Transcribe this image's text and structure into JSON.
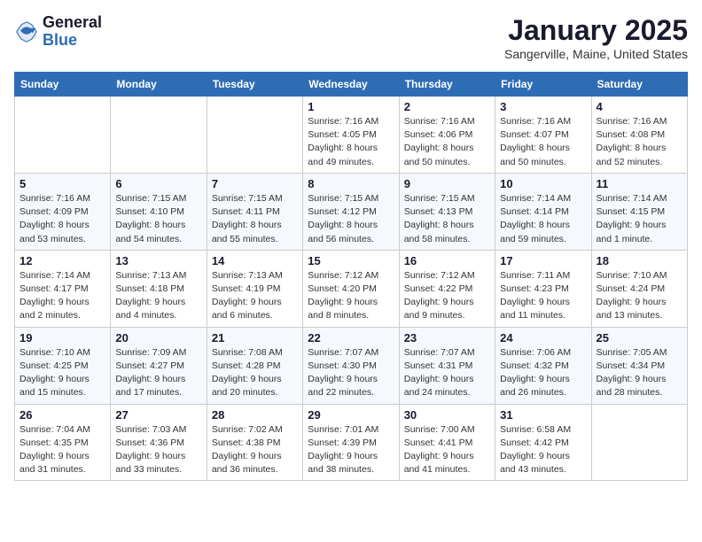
{
  "logo": {
    "line1": "General",
    "line2": "Blue"
  },
  "header": {
    "month": "January 2025",
    "location": "Sangerville, Maine, United States"
  },
  "weekdays": [
    "Sunday",
    "Monday",
    "Tuesday",
    "Wednesday",
    "Thursday",
    "Friday",
    "Saturday"
  ],
  "weeks": [
    [
      {
        "day": "",
        "info": ""
      },
      {
        "day": "",
        "info": ""
      },
      {
        "day": "",
        "info": ""
      },
      {
        "day": "1",
        "info": "Sunrise: 7:16 AM\nSunset: 4:05 PM\nDaylight: 8 hours\nand 49 minutes."
      },
      {
        "day": "2",
        "info": "Sunrise: 7:16 AM\nSunset: 4:06 PM\nDaylight: 8 hours\nand 50 minutes."
      },
      {
        "day": "3",
        "info": "Sunrise: 7:16 AM\nSunset: 4:07 PM\nDaylight: 8 hours\nand 50 minutes."
      },
      {
        "day": "4",
        "info": "Sunrise: 7:16 AM\nSunset: 4:08 PM\nDaylight: 8 hours\nand 52 minutes."
      }
    ],
    [
      {
        "day": "5",
        "info": "Sunrise: 7:16 AM\nSunset: 4:09 PM\nDaylight: 8 hours\nand 53 minutes."
      },
      {
        "day": "6",
        "info": "Sunrise: 7:15 AM\nSunset: 4:10 PM\nDaylight: 8 hours\nand 54 minutes."
      },
      {
        "day": "7",
        "info": "Sunrise: 7:15 AM\nSunset: 4:11 PM\nDaylight: 8 hours\nand 55 minutes."
      },
      {
        "day": "8",
        "info": "Sunrise: 7:15 AM\nSunset: 4:12 PM\nDaylight: 8 hours\nand 56 minutes."
      },
      {
        "day": "9",
        "info": "Sunrise: 7:15 AM\nSunset: 4:13 PM\nDaylight: 8 hours\nand 58 minutes."
      },
      {
        "day": "10",
        "info": "Sunrise: 7:14 AM\nSunset: 4:14 PM\nDaylight: 8 hours\nand 59 minutes."
      },
      {
        "day": "11",
        "info": "Sunrise: 7:14 AM\nSunset: 4:15 PM\nDaylight: 9 hours\nand 1 minute."
      }
    ],
    [
      {
        "day": "12",
        "info": "Sunrise: 7:14 AM\nSunset: 4:17 PM\nDaylight: 9 hours\nand 2 minutes."
      },
      {
        "day": "13",
        "info": "Sunrise: 7:13 AM\nSunset: 4:18 PM\nDaylight: 9 hours\nand 4 minutes."
      },
      {
        "day": "14",
        "info": "Sunrise: 7:13 AM\nSunset: 4:19 PM\nDaylight: 9 hours\nand 6 minutes."
      },
      {
        "day": "15",
        "info": "Sunrise: 7:12 AM\nSunset: 4:20 PM\nDaylight: 9 hours\nand 8 minutes."
      },
      {
        "day": "16",
        "info": "Sunrise: 7:12 AM\nSunset: 4:22 PM\nDaylight: 9 hours\nand 9 minutes."
      },
      {
        "day": "17",
        "info": "Sunrise: 7:11 AM\nSunset: 4:23 PM\nDaylight: 9 hours\nand 11 minutes."
      },
      {
        "day": "18",
        "info": "Sunrise: 7:10 AM\nSunset: 4:24 PM\nDaylight: 9 hours\nand 13 minutes."
      }
    ],
    [
      {
        "day": "19",
        "info": "Sunrise: 7:10 AM\nSunset: 4:25 PM\nDaylight: 9 hours\nand 15 minutes."
      },
      {
        "day": "20",
        "info": "Sunrise: 7:09 AM\nSunset: 4:27 PM\nDaylight: 9 hours\nand 17 minutes."
      },
      {
        "day": "21",
        "info": "Sunrise: 7:08 AM\nSunset: 4:28 PM\nDaylight: 9 hours\nand 20 minutes."
      },
      {
        "day": "22",
        "info": "Sunrise: 7:07 AM\nSunset: 4:30 PM\nDaylight: 9 hours\nand 22 minutes."
      },
      {
        "day": "23",
        "info": "Sunrise: 7:07 AM\nSunset: 4:31 PM\nDaylight: 9 hours\nand 24 minutes."
      },
      {
        "day": "24",
        "info": "Sunrise: 7:06 AM\nSunset: 4:32 PM\nDaylight: 9 hours\nand 26 minutes."
      },
      {
        "day": "25",
        "info": "Sunrise: 7:05 AM\nSunset: 4:34 PM\nDaylight: 9 hours\nand 28 minutes."
      }
    ],
    [
      {
        "day": "26",
        "info": "Sunrise: 7:04 AM\nSunset: 4:35 PM\nDaylight: 9 hours\nand 31 minutes."
      },
      {
        "day": "27",
        "info": "Sunrise: 7:03 AM\nSunset: 4:36 PM\nDaylight: 9 hours\nand 33 minutes."
      },
      {
        "day": "28",
        "info": "Sunrise: 7:02 AM\nSunset: 4:38 PM\nDaylight: 9 hours\nand 36 minutes."
      },
      {
        "day": "29",
        "info": "Sunrise: 7:01 AM\nSunset: 4:39 PM\nDaylight: 9 hours\nand 38 minutes."
      },
      {
        "day": "30",
        "info": "Sunrise: 7:00 AM\nSunset: 4:41 PM\nDaylight: 9 hours\nand 41 minutes."
      },
      {
        "day": "31",
        "info": "Sunrise: 6:58 AM\nSunset: 4:42 PM\nDaylight: 9 hours\nand 43 minutes."
      },
      {
        "day": "",
        "info": ""
      }
    ]
  ]
}
